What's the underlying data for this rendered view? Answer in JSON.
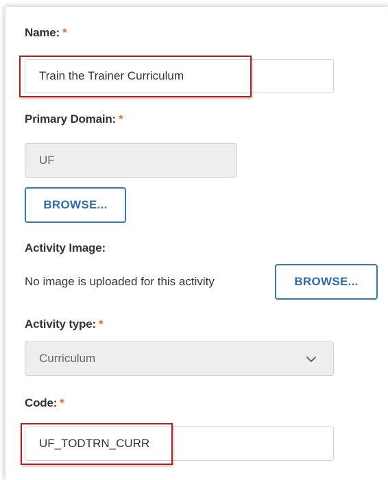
{
  "form": {
    "name": {
      "label": "Name:",
      "required_mark": "*",
      "value": "Train the Trainer Curriculum"
    },
    "primary_domain": {
      "label": "Primary Domain:",
      "required_mark": "*",
      "value": "UF",
      "browse_label": "BROWSE..."
    },
    "activity_image": {
      "label": "Activity Image:",
      "status_text": "No image is uploaded for this activity",
      "browse_label": "BROWSE..."
    },
    "activity_type": {
      "label": "Activity type:",
      "required_mark": "*",
      "selected": "Curriculum",
      "icon": "chevron-down-icon"
    },
    "code": {
      "label": "Code:",
      "required_mark": "*",
      "value": "UF_TODTRN_CURR"
    }
  },
  "colors": {
    "required": "#e06b2c",
    "highlight": "#b71c1c",
    "button_border": "#2e7bb6",
    "button_text": "#2e6fa8",
    "readonly_bg": "#eeeeee"
  }
}
